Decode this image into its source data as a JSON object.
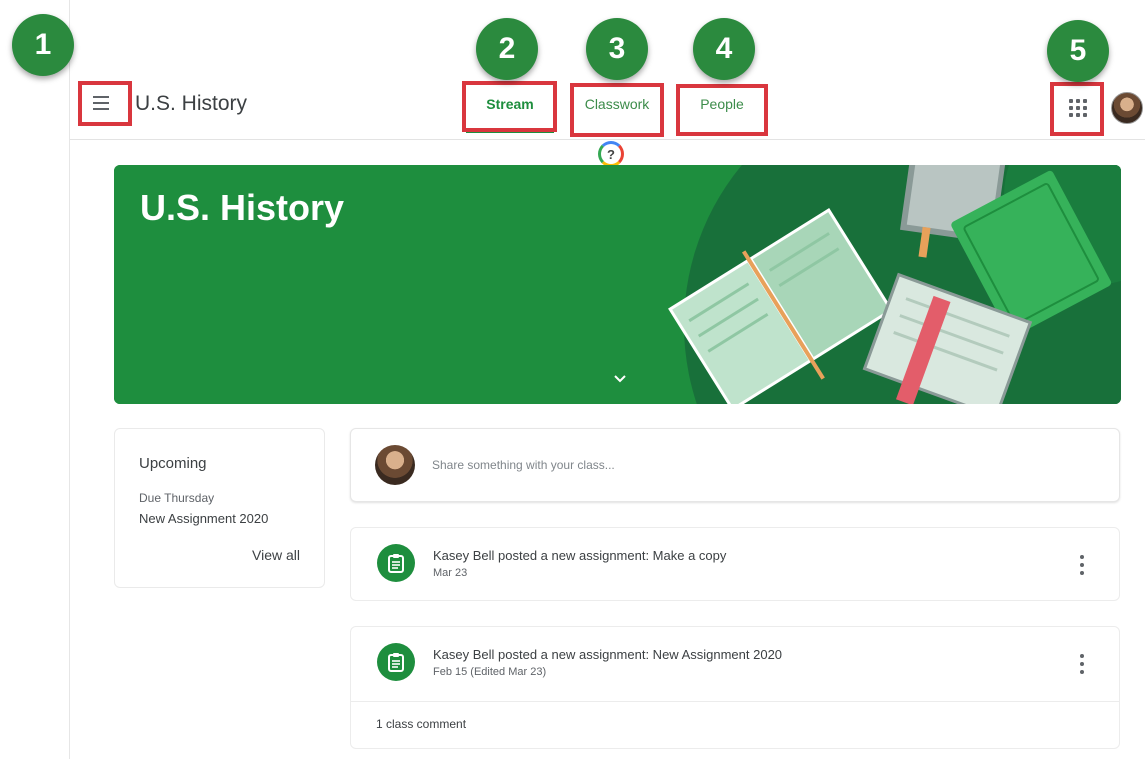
{
  "header": {
    "menu_icon": "hamburger-menu-icon",
    "class_title": "U.S. History",
    "tabs": [
      {
        "label": "Stream",
        "selected": true
      },
      {
        "label": "Classwork",
        "selected": false
      },
      {
        "label": "People",
        "selected": false
      }
    ],
    "apps_icon": "apps-grid-icon",
    "help_label": "?"
  },
  "annotations": [
    "1",
    "2",
    "3",
    "4",
    "5"
  ],
  "banner": {
    "title": "U.S. History",
    "chevron_icon": "chevron-down-icon"
  },
  "upcoming": {
    "title": "Upcoming",
    "due_label": "Due Thursday",
    "item": "New Assignment 2020",
    "view_all": "View all"
  },
  "share": {
    "placeholder": "Share something with your class..."
  },
  "posts": [
    {
      "title": "Kasey Bell posted a new assignment: Make a copy",
      "date": "Mar 23"
    },
    {
      "title": "Kasey Bell posted a new assignment: New Assignment 2020",
      "date": "Feb 15 (Edited Mar 23)",
      "comments": "1 class comment"
    }
  ],
  "colors": {
    "accent": "#1e8e3e",
    "callout": "#2b8a3e",
    "highlight": "#d9363e"
  }
}
